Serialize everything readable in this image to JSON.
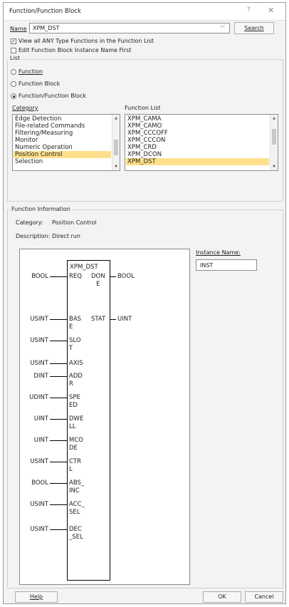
{
  "title": "Function/Function Block",
  "title_buttons": {
    "help": "?",
    "close": "✕"
  },
  "name": {
    "label": "Name",
    "value": "XPM_DST",
    "search": "Search"
  },
  "options": {
    "view_all": "View all ANY Type Functions in the Function List",
    "view_all_checked": true,
    "edit_fb_first": "Edit Function Block Instance Name First",
    "edit_fb_first_checked": false
  },
  "list_group": {
    "title": "List",
    "radios": [
      "Function",
      "Function Block",
      "Function/Function Block"
    ],
    "selected": 2,
    "category_label": "Category",
    "function_list_label": "Function List",
    "categories": [
      "Edge Detection",
      "File-related Commands",
      "Filtering/Measuring",
      "Monitor",
      "Numeric Operation",
      "Position Control",
      "Selection"
    ],
    "category_selected": 5,
    "functions": [
      "XPM_CAMA",
      "XPM_CAMO",
      "XPM_CCCOFF",
      "XPM_CCCON",
      "XPM_CRD",
      "XPM_DCON",
      "XPM_DST"
    ],
    "function_selected": 6
  },
  "info": {
    "title": "Function Information",
    "category_label": "Category:",
    "category_value": "Position Control",
    "description_label": "Description:",
    "description_value": "Direct run"
  },
  "block": {
    "name": "XPM_DST",
    "inputs": [
      {
        "type": "BOOL",
        "pin": "REQ"
      },
      {
        "type": "USINT",
        "pin": "BAS\nE"
      },
      {
        "type": "USINT",
        "pin": "SLO\nT"
      },
      {
        "type": "USINT",
        "pin": "AXIS"
      },
      {
        "type": "DINT",
        "pin": "ADD\nR"
      },
      {
        "type": "UDINT",
        "pin": "SPE\nED"
      },
      {
        "type": "UINT",
        "pin": "DWE\nLL"
      },
      {
        "type": "UINT",
        "pin": "MCO\nDE"
      },
      {
        "type": "USINT",
        "pin": "CTR\nL"
      },
      {
        "type": "BOOL",
        "pin": "ABS_\nINC"
      },
      {
        "type": "USINT",
        "pin": "ACC_\nSEL"
      },
      {
        "type": "USINT",
        "pin": "DEC\n_SEL"
      }
    ],
    "outputs": [
      {
        "pin": "DON\nE",
        "type": "BOOL"
      },
      {
        "pin": "STAT",
        "type": "UINT"
      }
    ]
  },
  "instance": {
    "label": "Instance Name:",
    "value": "INST"
  },
  "footer": {
    "help": "Help",
    "ok": "OK",
    "cancel": "Cancel"
  }
}
